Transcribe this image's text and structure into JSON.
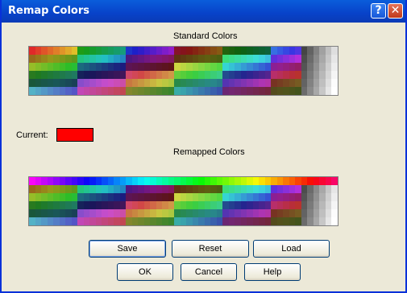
{
  "window": {
    "title": "Remap Colors",
    "help_glyph": "?",
    "close_glyph": "✕"
  },
  "standard": {
    "label": "Standard Colors"
  },
  "current": {
    "label": "Current:",
    "color": "#ff0000"
  },
  "remapped": {
    "label": "Remapped Colors"
  },
  "buttons": {
    "save": "Save",
    "reset": "Reset",
    "load": "Load",
    "ok": "OK",
    "cancel": "Cancel",
    "help": "Help"
  },
  "icons": {
    "help": "help-icon",
    "close": "close-icon"
  }
}
